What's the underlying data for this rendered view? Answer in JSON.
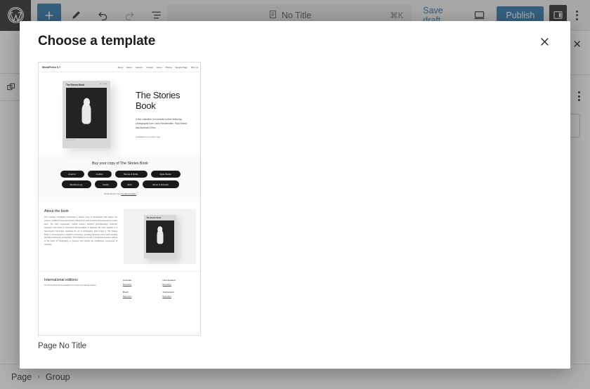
{
  "topbar": {
    "logo_icon": "wordpress-logo-icon",
    "add_icon": "plus-icon",
    "edit_icon": "pencil-icon",
    "undo_icon": "undo-arrow-icon",
    "redo_icon": "redo-arrow-icon",
    "list_view_icon": "list-view-icon",
    "command_doc_icon": "document-icon",
    "command_title": "No Title",
    "command_shortcut": "⌘K",
    "save_draft_label": "Save draft",
    "preview_icon": "desktop-preview-icon",
    "publish_label": "Publish",
    "settings_icon": "sidebar-panel-icon",
    "options_icon": "kebab-menu-icon"
  },
  "left_rail": {
    "block_icon": "copy-blocks-icon"
  },
  "right_rail": {
    "close_icon": "close-x-icon",
    "options_icon": "kebab-menu-icon"
  },
  "canvas": {
    "partial_text": "Available for pre-order now."
  },
  "statusbar": {
    "crumbs": [
      "Page",
      "Group"
    ],
    "separator": "›"
  },
  "modal": {
    "title": "Choose a template",
    "close_icon": "close-x-icon",
    "template": {
      "caption": "Page No Title",
      "preview": {
        "nav": {
          "brand": "WordPress 6.7",
          "links": [
            "About",
            "About",
            "Careers",
            "Contact",
            "Home",
            "Pricing",
            "Sample Page",
            "Why Us"
          ]
        },
        "hero": {
          "cover_title": "The Stories Book",
          "cover_tag": "01 — 2024",
          "cover_foot": "Photography",
          "heading": "The Stories Book",
          "paragraph": "A fine collection of moments in time featuring photographs from Louis Fleckenstein, Paul Strand and Asahachi Kōno.",
          "availability": "Available for pre-order now."
        },
        "buy": {
          "heading": "Buy your copy of The Stories Book",
          "row1": [
            "Amazon",
            "Audible",
            "Barnes & Noble",
            "Apple Books"
          ],
          "row2": [
            "Bookshop.org",
            "Spotify",
            "Ebid",
            "Simon & Schuster"
          ],
          "note_prefix": "Outside Europe? View ",
          "note_link": "international editions"
        },
        "about": {
          "heading": "About the book",
          "paragraph": "This exquisite compilation showcases a diverse array of photographs that capture the essence of different eras and cultures, reflecting the unique stories and perspectives of each artist. The work meticulously curated imagery, blending groundbreaking modernist approach, and strives to meticulous documentation of Japanese life come together in a harmoniously blend that celebrates the art of photography. Each image in \"The Stories Book\" is accompanied by insightful commentary, providing historical context and revealing the stories behind the photographs. This collection is not only a visual feast but also a tribute to the power of photography to preserve and narrate the multifaceted experiences of humanity.",
          "cover_title": "The Stories Book"
        },
        "international": {
          "heading": "International editions",
          "subtitle": "The Stories Book will be available from these international retailers.",
          "entries": [
            {
              "country": "Australia",
              "link": "Book Store"
            },
            {
              "country": "New Zealand",
              "link": "Book Store"
            },
            {
              "country": "Brazil",
              "link": "Book Store"
            },
            {
              "country": "Switzerland",
              "link": "Book Store"
            }
          ]
        }
      }
    }
  },
  "colors": {
    "accent_blue": "#1e6ea7",
    "toolbar_bg": "#f0f0f0",
    "dark": "#1e1e1e"
  }
}
